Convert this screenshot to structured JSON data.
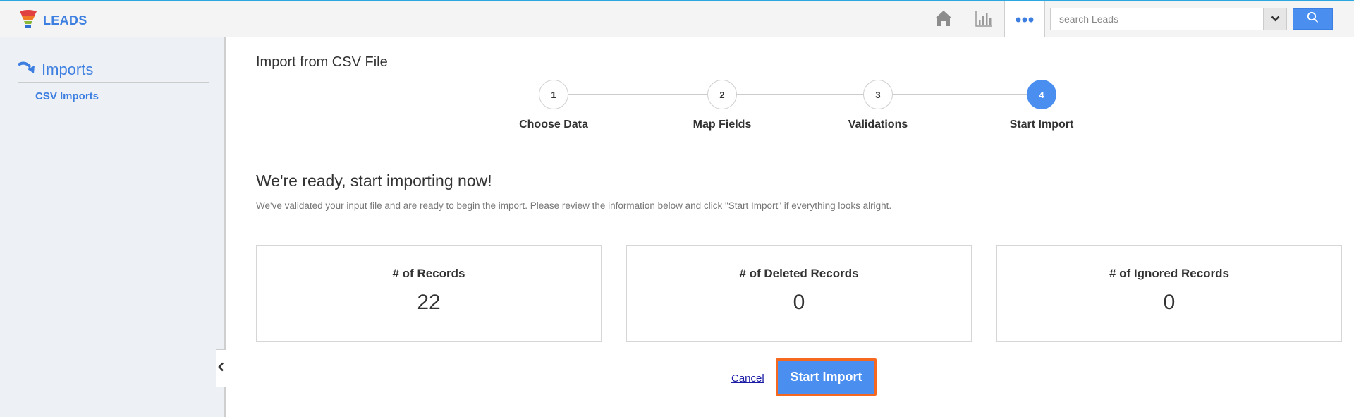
{
  "app": {
    "title": "LEADS",
    "accent": "#3d7fe0",
    "header_stripe": "#2aa8e0"
  },
  "topbar": {
    "icons": [
      "home-icon",
      "reports-chart-icon",
      "more-dots-icon"
    ],
    "search": {
      "placeholder": "search Leads",
      "value": ""
    }
  },
  "sidebar": {
    "section_label": "Imports",
    "items": [
      {
        "label": "CSV Imports"
      }
    ]
  },
  "main": {
    "page_title": "Import from CSV File",
    "steps": [
      {
        "number": "1",
        "label": "Choose Data",
        "active": false
      },
      {
        "number": "2",
        "label": "Map Fields",
        "active": false
      },
      {
        "number": "3",
        "label": "Validations",
        "active": false
      },
      {
        "number": "4",
        "label": "Start Import",
        "active": true
      }
    ],
    "ready_title": "We're ready, start importing now!",
    "ready_desc": "We've validated your input file and are ready to begin the import. Please review the information below and click \"Start Import\" if everything looks alright.",
    "stats": [
      {
        "label": "# of Records",
        "value": "22"
      },
      {
        "label": "# of Deleted Records",
        "value": "0"
      },
      {
        "label": "# of Ignored Records",
        "value": "0"
      }
    ],
    "cancel_label": "Cancel",
    "start_label": "Start Import",
    "start_button_color": "#4a8ff0",
    "start_button_border": "#f4681f"
  }
}
